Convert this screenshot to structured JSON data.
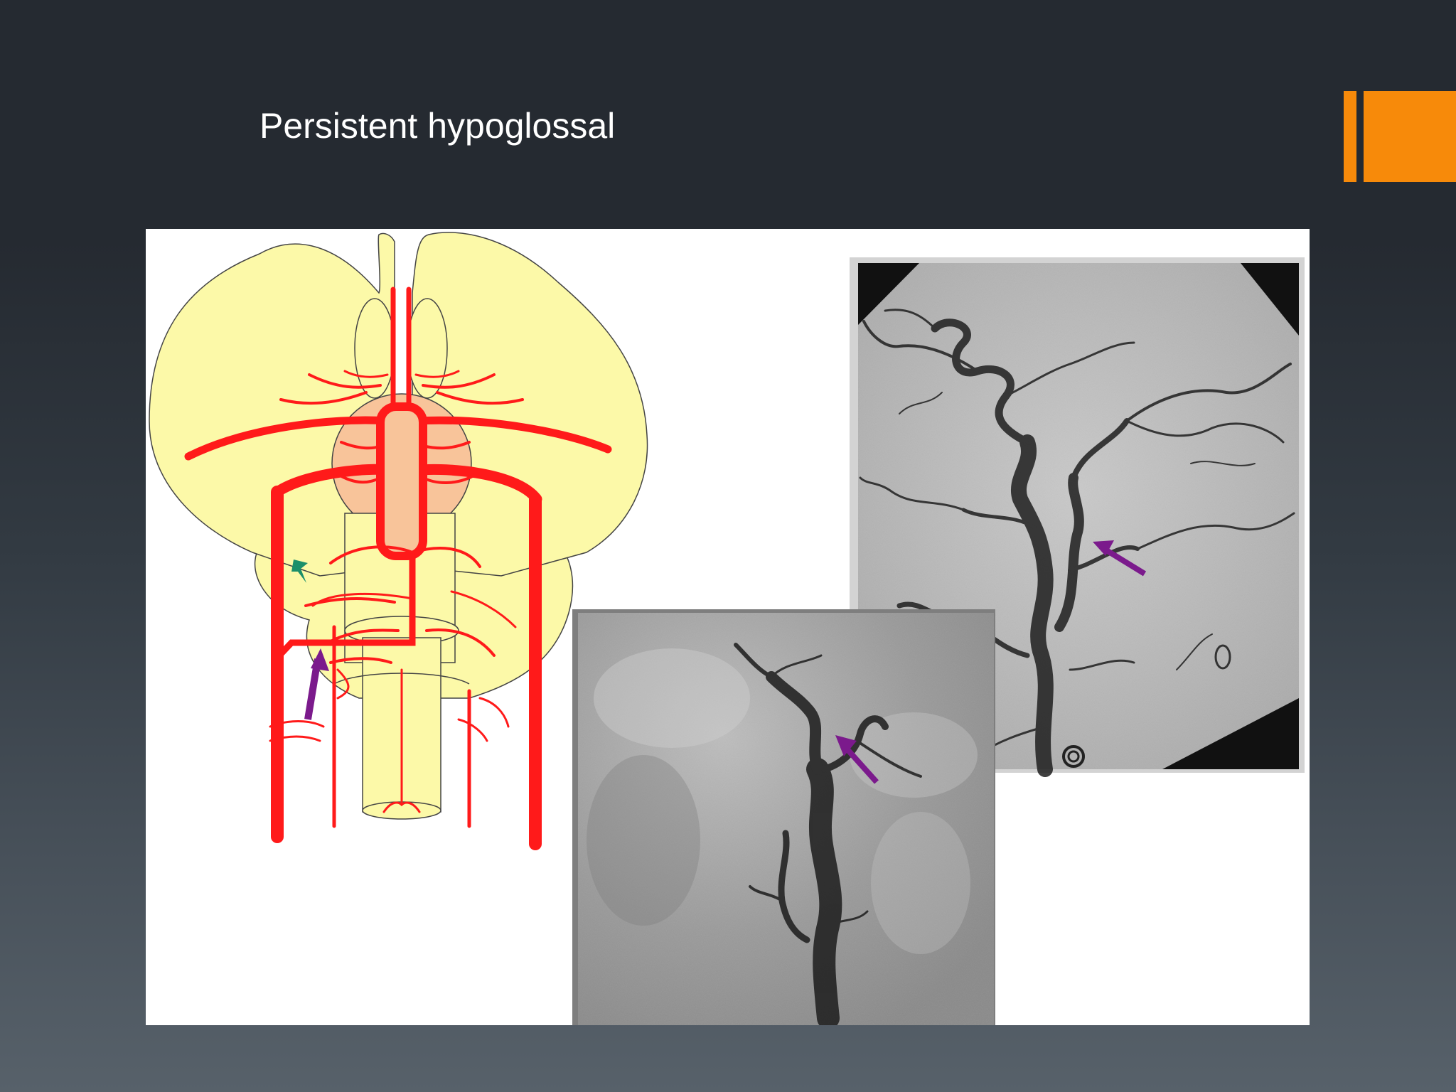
{
  "slide": {
    "title": "Persistent hypoglossal"
  },
  "colors": {
    "background_top": "#252a31",
    "background_bottom": "#57616a",
    "accent": "#f78a0a",
    "artery_red": "#ff1a1a",
    "brain_yellow": "#fcf9a8",
    "pons_peach": "#f8c49a",
    "arrow_purple": "#7b1a8c",
    "arrowhead_green": "#1b8f6a"
  },
  "figure": {
    "panels": [
      "schematic-diagram",
      "lateral-angiogram",
      "frontal-angiogram"
    ],
    "markers": {
      "schematic": [
        "green-arrowhead",
        "purple-arrow"
      ],
      "angiogram_lateral": [
        "purple-arrow"
      ],
      "angiogram_frontal": [
        "purple-arrow"
      ]
    }
  }
}
